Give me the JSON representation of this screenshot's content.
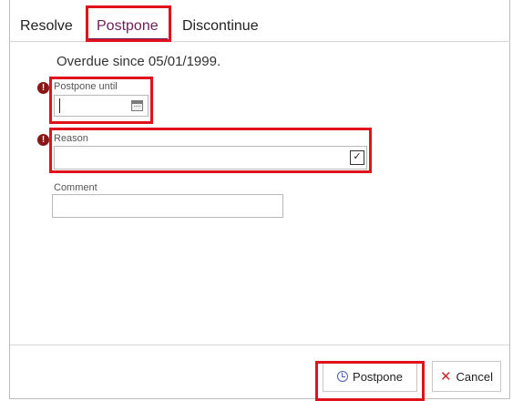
{
  "tabs": [
    {
      "label": "Resolve",
      "active": false
    },
    {
      "label": "Postpone",
      "active": true
    },
    {
      "label": "Discontinue",
      "active": false
    }
  ],
  "status": {
    "overdue_text": "Overdue since 05/01/1999."
  },
  "form": {
    "postpone_until": {
      "label": "Postpone until",
      "value": "",
      "required": true,
      "icon": "calendar-icon"
    },
    "reason": {
      "label": "Reason",
      "value": "",
      "required": true,
      "icon": "chevron-down-icon"
    },
    "comment": {
      "label": "Comment",
      "value": ""
    }
  },
  "footer": {
    "postpone_label": "Postpone",
    "postpone_icon": "clock-icon",
    "cancel_label": "Cancel",
    "cancel_icon": "close-icon"
  },
  "colors": {
    "accent": "#6b1f5c",
    "highlight": "#e0121c",
    "required": "#8b1616",
    "cancel": "#c62828"
  }
}
